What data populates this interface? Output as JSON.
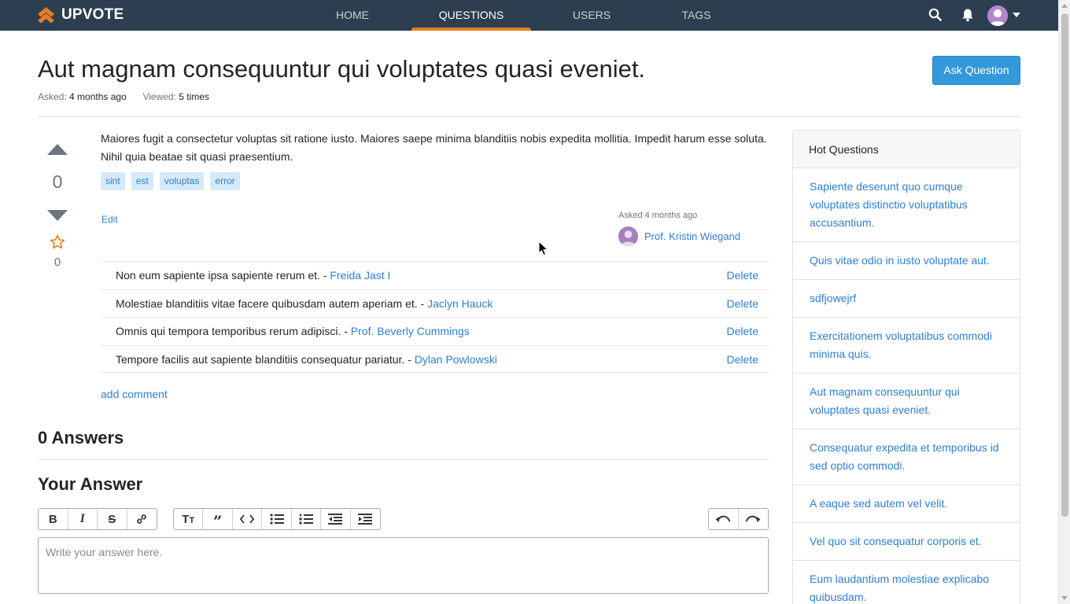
{
  "nav": {
    "brand": "UPVOTE",
    "items": [
      "HOME",
      "QUESTIONS",
      "USERS",
      "TAGS"
    ],
    "active": "QUESTIONS"
  },
  "question": {
    "title": "Aut magnam consequuntur qui voluptates quasi eveniet.",
    "asked_label": "Asked:",
    "asked_value": "4 months ago",
    "viewed_label": "Viewed:",
    "viewed_value": "5 times",
    "ask_button": "Ask Question",
    "votes": "0",
    "favorites": "0",
    "body": "Maiores fugit a consectetur voluptas sit ratione iusto. Maiores saepe minima blanditiis nobis expedita mollitia. Impedit harum esse soluta. Nihil quia beatae sit quasi praesentium.",
    "tags": [
      "sint",
      "est",
      "voluptas",
      "error"
    ],
    "edit_label": "Edit",
    "asked_by_label": "Asked 4 months ago",
    "author": "Prof. Kristin Wiegand"
  },
  "comments": [
    {
      "text": "Non eum sapiente ipsa sapiente rerum et. -",
      "author": "Freida Jast I",
      "action": "Delete"
    },
    {
      "text": "Molestiae blanditiis vitae facere quibusdam autem aperiam et. -",
      "author": "Jaclyn Hauck",
      "action": "Delete"
    },
    {
      "text": "Omnis qui tempora temporibus rerum adipisci. -",
      "author": "Prof. Beverly Cummings",
      "action": "Delete"
    },
    {
      "text": "Tempore facilis aut sapiente blanditiis consequatur pariatur. -",
      "author": "Dylan Powlowski",
      "action": "Delete"
    }
  ],
  "add_comment": "add comment",
  "answers_heading": "0 Answers",
  "your_answer_heading": "Your Answer",
  "editor": {
    "placeholder": "Write your answer here.",
    "toolbar": [
      "bold-icon",
      "italic-icon",
      "strikethrough-icon",
      "link-icon",
      "heading-icon",
      "quote-icon",
      "code-icon",
      "bullet-list-icon",
      "numbered-list-icon",
      "outdent-icon",
      "indent-icon",
      "undo-icon",
      "redo-icon"
    ]
  },
  "hot_questions": {
    "title": "Hot Questions",
    "items": [
      "Sapiente deserunt quo cumque voluptates distinctio voluptatibus accusantium.",
      "Quis vitae odio in iusto voluptate aut.",
      "sdfjowejrf",
      "Exercitationem voluptatibus commodi minima quis.",
      "Aut magnam consequuntur qui voluptates quasi eveniet.",
      "Consequatur expedita et temporibus id sed optio commodi.",
      "A eaque sed autem vel velit.",
      "Vel quo sit consequatur corporis et.",
      "Eum laudantium molestiae explicabo quibusdam."
    ]
  },
  "colors": {
    "navbar": "#2c3e50",
    "accent": "#e67e22",
    "primary": "#3498db",
    "link": "#2f7fd0"
  }
}
